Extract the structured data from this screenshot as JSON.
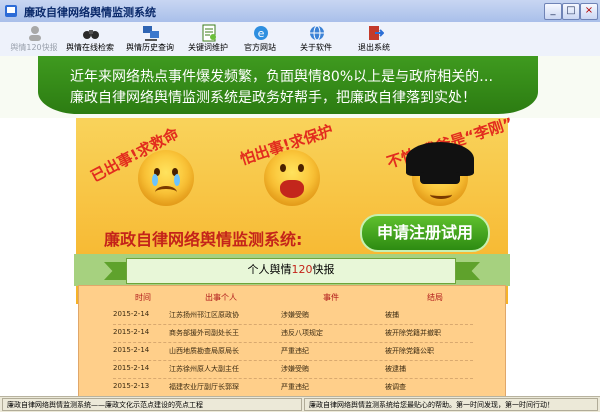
{
  "window": {
    "title": "廉政自律网络舆情监测系统",
    "min_label": "_",
    "max_label": "□",
    "close_label": "×"
  },
  "toolbar": {
    "items": [
      {
        "label": "舆情120快报",
        "icon": "user-icon",
        "enabled": false
      },
      {
        "label": "舆情在线检索",
        "icon": "binoculars-icon",
        "enabled": true
      },
      {
        "label": "舆情历史查询",
        "icon": "computers-icon",
        "enabled": true
      },
      {
        "label": "关键词维护",
        "icon": "edit-doc-icon",
        "enabled": true
      },
      {
        "label": "官方网站",
        "icon": "ie-icon",
        "enabled": true
      },
      {
        "label": "关于软件",
        "icon": "globe-icon",
        "enabled": true
      },
      {
        "label": "退出系统",
        "icon": "exit-icon",
        "enabled": true
      }
    ]
  },
  "header": {
    "line1": "近年来网络热点事件爆发频繁，负面舆情80%以上是与政府相关的…",
    "line2": "廉政自律网络舆情监测系统是政务好帮手，把廉政自律落到实处！"
  },
  "poster": {
    "slogan1": "已出事!求救命",
    "slogan2": "怕出事!求保护",
    "slogan3": "不怕!我爸是“李刚”",
    "title": "廉政自律网络舆情监测系统:",
    "register_label": "申请注册试用"
  },
  "section": {
    "title_prefix": "个人舆情",
    "title_num": "120",
    "title_suffix": "快报"
  },
  "table": {
    "headers": [
      "时间",
      "出事个人",
      "事件",
      "结局"
    ],
    "rows": [
      [
        "2015-2-14",
        "江苏扬州邗江区原政协",
        "涉嫌受贿",
        "被捕"
      ],
      [
        "2015-2-14",
        "商务部援外司副处长王",
        "违反八项规定",
        "被开除党籍并撤职"
      ],
      [
        "2015-2-14",
        "山西地质勘查局原局长",
        "严重违纪",
        "被开除党籍公职"
      ],
      [
        "2015-2-14",
        "江苏徐州原人大副主任",
        "涉嫌受贿",
        "被逮捕"
      ],
      [
        "2015-2-13",
        "福建农业厅副厅长郭琛",
        "严重违纪",
        "被调查"
      ]
    ]
  },
  "status": {
    "left": "廉政自律网络舆情监测系统——廉政文化示范点建设的亮点工程",
    "right": "廉政自律网络舆情监测系统给您最贴心的帮助。第一时间发现，第一时间行动！"
  },
  "colors": {
    "green": "#2c7c12",
    "red": "#c4241a",
    "accent": "#f6b126"
  }
}
